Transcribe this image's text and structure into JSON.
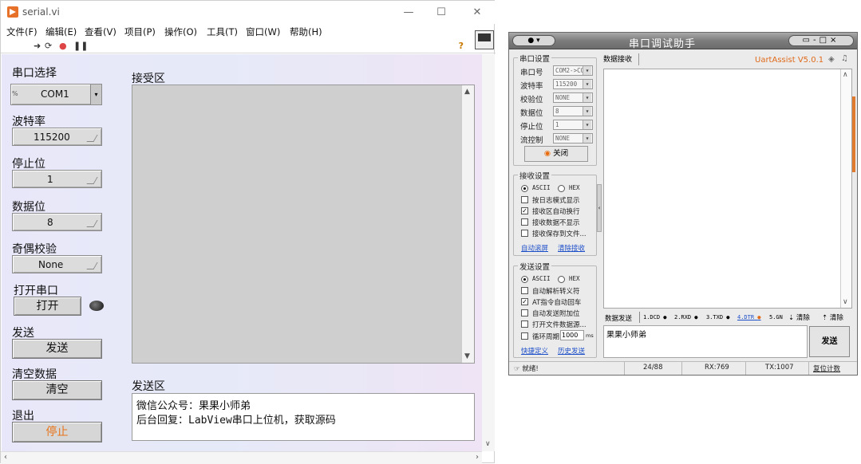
{
  "labview": {
    "title": "serial.vi",
    "window_buttons": [
      "—",
      "☐",
      "✕"
    ],
    "menu": [
      "文件(F)",
      "编辑(E)",
      "查看(V)",
      "项目(P)",
      "操作(O)",
      "工具(T)",
      "窗口(W)",
      "帮助(H)"
    ],
    "toolbar_icons": [
      "run-arrow-icon",
      "run-continuously-icon",
      "abort-icon",
      "pause-icon"
    ],
    "help_icon": "?",
    "controls": {
      "port_label": "串口选择",
      "port_value": "COM1",
      "port_prefix": "%",
      "baud_label": "波特率",
      "baud_value": "115200",
      "stopbit_label": "停止位",
      "stopbit_value": "1",
      "databit_label": "数据位",
      "databit_value": "8",
      "parity_label": "奇偶校验",
      "parity_value": "None",
      "open_label": "打开串口",
      "open_button": "打开",
      "send_label": "发送",
      "send_button": "发送",
      "clear_label": "清空数据",
      "clear_button": "清空",
      "exit_label": "退出",
      "exit_button": "停止"
    },
    "receive_label": "接受区",
    "send_area_label": "发送区",
    "send_text_line1": "微信公众号：果果小师弟",
    "send_text_line2": "后台回复：LabView串口上位机，获取源码",
    "colors": {
      "stop_button_text": "#e8731a",
      "panel_bg": "#e8e7f9"
    }
  },
  "uart": {
    "title": "串口调试助手",
    "version": "UartAssist V5.0.1",
    "serial_settings": {
      "title": "串口设置",
      "rows": [
        {
          "label": "串口号",
          "value": "COM2->CO"
        },
        {
          "label": "波特率",
          "value": "115200"
        },
        {
          "label": "校验位",
          "value": "NONE"
        },
        {
          "label": "数据位",
          "value": "8"
        },
        {
          "label": "停止位",
          "value": "1"
        },
        {
          "label": "流控制",
          "value": "NONE"
        }
      ],
      "close_button": "关闭"
    },
    "recv_settings": {
      "title": "接收设置",
      "ascii": "ASCII",
      "hex": "HEX",
      "options": [
        {
          "label": "按日志模式显示",
          "checked": false
        },
        {
          "label": "接收区自动换行",
          "checked": true
        },
        {
          "label": "接收数据不显示",
          "checked": false
        },
        {
          "label": "接收保存到文件...",
          "checked": false
        }
      ],
      "link1": "自动滚屏",
      "link2": "清除接收"
    },
    "send_settings": {
      "title": "发送设置",
      "ascii": "ASCII",
      "hex": "HEX",
      "options": [
        {
          "label": "自动解析转义符",
          "checked": false
        },
        {
          "label": "AT指令自动回车",
          "checked": true
        },
        {
          "label": "自动发送附加位",
          "checked": false
        },
        {
          "label": "打开文件数据源...",
          "checked": false
        }
      ],
      "cycle_label": "循环周期",
      "cycle_value": "1000",
      "cycle_unit": "ms",
      "link1": "快捷定义",
      "link2": "历史发送"
    },
    "recv_tab": "数据接收",
    "send_bar": {
      "tab": "数据发送",
      "items": [
        "1.DCD",
        "2.RXD",
        "3.TXD",
        "4.DTR",
        "5.GN"
      ],
      "clear1": "清除",
      "clear2": "清除"
    },
    "send_text": "果果小师弟",
    "send_button": "发送",
    "status": {
      "ready": "就绪!",
      "count": "24/88",
      "rx": "RX:769",
      "tx": "TX:1007",
      "reset": "复位计数"
    },
    "colors": {
      "title_bar": "#7c7c7c",
      "version": "#e06a1a",
      "link": "#1d4fc9"
    }
  }
}
